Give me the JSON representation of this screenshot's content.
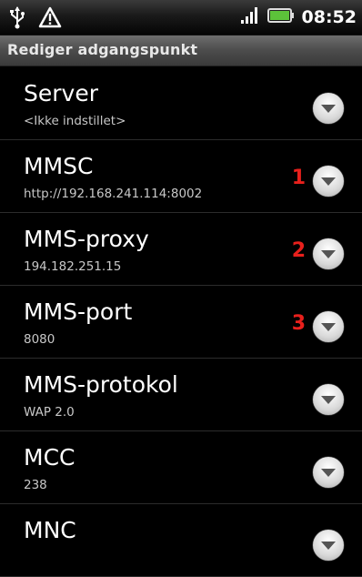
{
  "status_bar": {
    "time": "08:52",
    "icons": [
      "usb-icon",
      "warning-icon",
      "signal-icon",
      "battery-icon"
    ]
  },
  "header": {
    "title": "Rediger adgangspunkt"
  },
  "colors": {
    "marker": "#e8201c",
    "background": "#000000",
    "title_bar": "#4c4c4c"
  },
  "items": [
    {
      "title": "Server",
      "summary": "<Ikke indstillet>",
      "marker": ""
    },
    {
      "title": "MMSC",
      "summary": "http://192.168.241.114:8002",
      "marker": "1"
    },
    {
      "title": "MMS-proxy",
      "summary": "194.182.251.15",
      "marker": "2"
    },
    {
      "title": "MMS-port",
      "summary": "8080",
      "marker": "3"
    },
    {
      "title": "MMS-protokol",
      "summary": "WAP 2.0",
      "marker": ""
    },
    {
      "title": "MCC",
      "summary": "238",
      "marker": ""
    },
    {
      "title": "MNC",
      "summary": "",
      "marker": ""
    }
  ]
}
